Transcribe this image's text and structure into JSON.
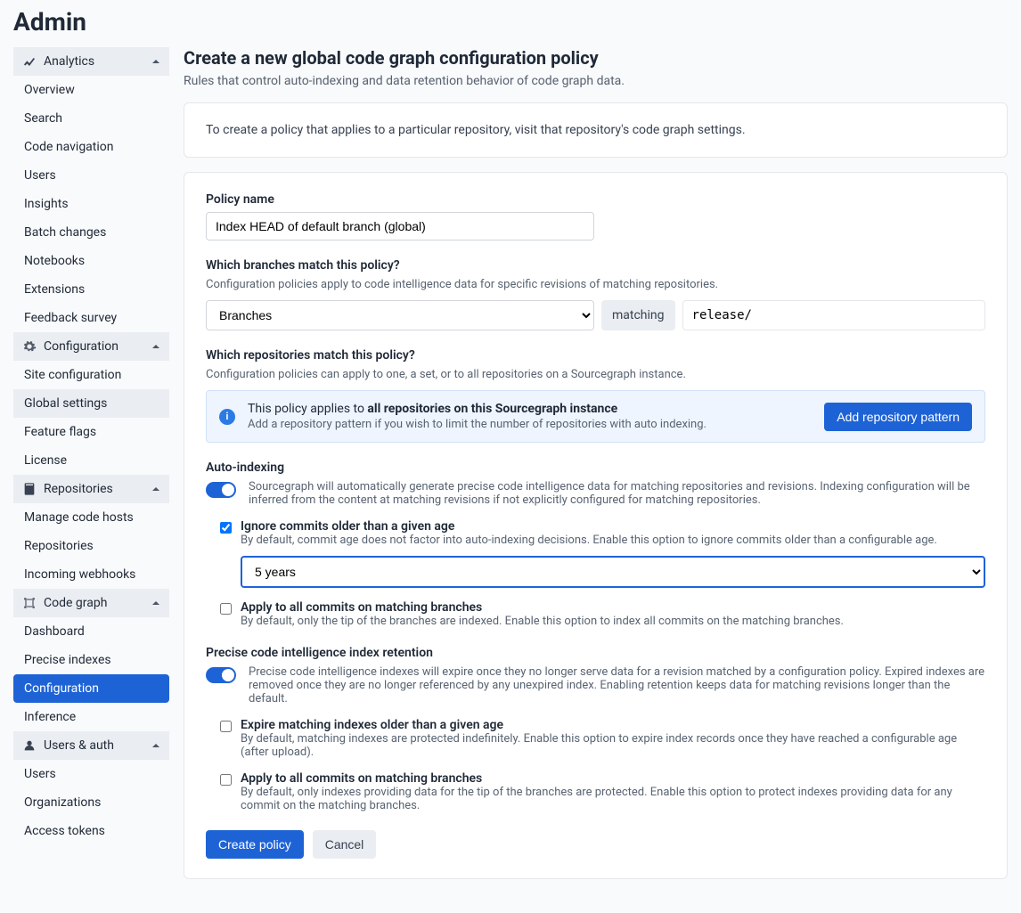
{
  "page_title": "Admin",
  "sidebar": {
    "sections": [
      {
        "title": "Analytics",
        "items": [
          "Overview",
          "Search",
          "Code navigation",
          "Users",
          "Insights",
          "Batch changes",
          "Notebooks",
          "Extensions",
          "Feedback survey"
        ]
      },
      {
        "title": "Configuration",
        "items": [
          "Site configuration",
          "Global settings",
          "Feature flags",
          "License"
        ],
        "active_sub_index": 1
      },
      {
        "title": "Repositories",
        "items": [
          "Manage code hosts",
          "Repositories",
          "Incoming webhooks"
        ]
      },
      {
        "title": "Code graph",
        "items": [
          "Dashboard",
          "Precise indexes",
          "Configuration",
          "Inference"
        ],
        "active_index": 2
      },
      {
        "title": "Users & auth",
        "items": [
          "Users",
          "Organizations",
          "Access tokens"
        ]
      }
    ]
  },
  "form": {
    "title": "Create a new global code graph configuration policy",
    "subtitle": "Rules that control auto-indexing and data retention behavior of code graph data.",
    "info_card": "To create a policy that applies to a particular repository, visit that repository's code graph settings.",
    "policy_name_label": "Policy name",
    "policy_name_value": "Index HEAD of default branch (global)",
    "branches": {
      "label": "Which branches match this policy?",
      "help": "Configuration policies apply to code intelligence data for specific revisions of matching repositories.",
      "type_value": "Branches",
      "matching_label": "matching",
      "pattern_value": "release/"
    },
    "repos": {
      "label": "Which repositories match this policy?",
      "help": "Configuration policies can apply to one, a set, or to all repositories on a Sourcegraph instance.",
      "alert_prefix": "This policy applies to ",
      "alert_bold": "all repositories",
      "alert_suffix": " on this Sourcegraph instance",
      "alert_sub": "Add a repository pattern if you wish to limit the number of repositories with auto indexing.",
      "button": "Add repository pattern"
    },
    "autoindex": {
      "label": "Auto-indexing",
      "help": "Sourcegraph will automatically generate precise code intelligence data for matching repositories and revisions. Indexing configuration will be inferred from the content at matching revisions if not explicitly configured for matching repositories.",
      "ignore_label": "Ignore commits older than a given age",
      "ignore_help": "By default, commit age does not factor into auto-indexing decisions. Enable this option to ignore commits older than a configurable age.",
      "ignore_value": "5 years",
      "ignore_checked": true,
      "all_commits_label": "Apply to all commits on matching branches",
      "all_commits_help": "By default, only the tip of the branches are indexed. Enable this option to index all commits on the matching branches.",
      "all_commits_checked": false
    },
    "retention": {
      "label": "Precise code intelligence index retention",
      "help": "Precise code intelligence indexes will expire once they no longer serve data for a revision matched by a configuration policy. Expired indexes are removed once they are no longer referenced by any unexpired index. Enabling retention keeps data for matching revisions longer than the default.",
      "expire_label": "Expire matching indexes older than a given age",
      "expire_help": "By default, matching indexes are protected indefinitely. Enable this option to expire index records once they have reached a configurable age (after upload).",
      "expire_checked": false,
      "all_commits_label": "Apply to all commits on matching branches",
      "all_commits_help": "By default, only indexes providing data for the tip of the branches are protected. Enable this option to protect indexes providing data for any commit on the matching branches.",
      "all_commits_checked": false
    },
    "actions": {
      "create": "Create policy",
      "cancel": "Cancel"
    }
  }
}
